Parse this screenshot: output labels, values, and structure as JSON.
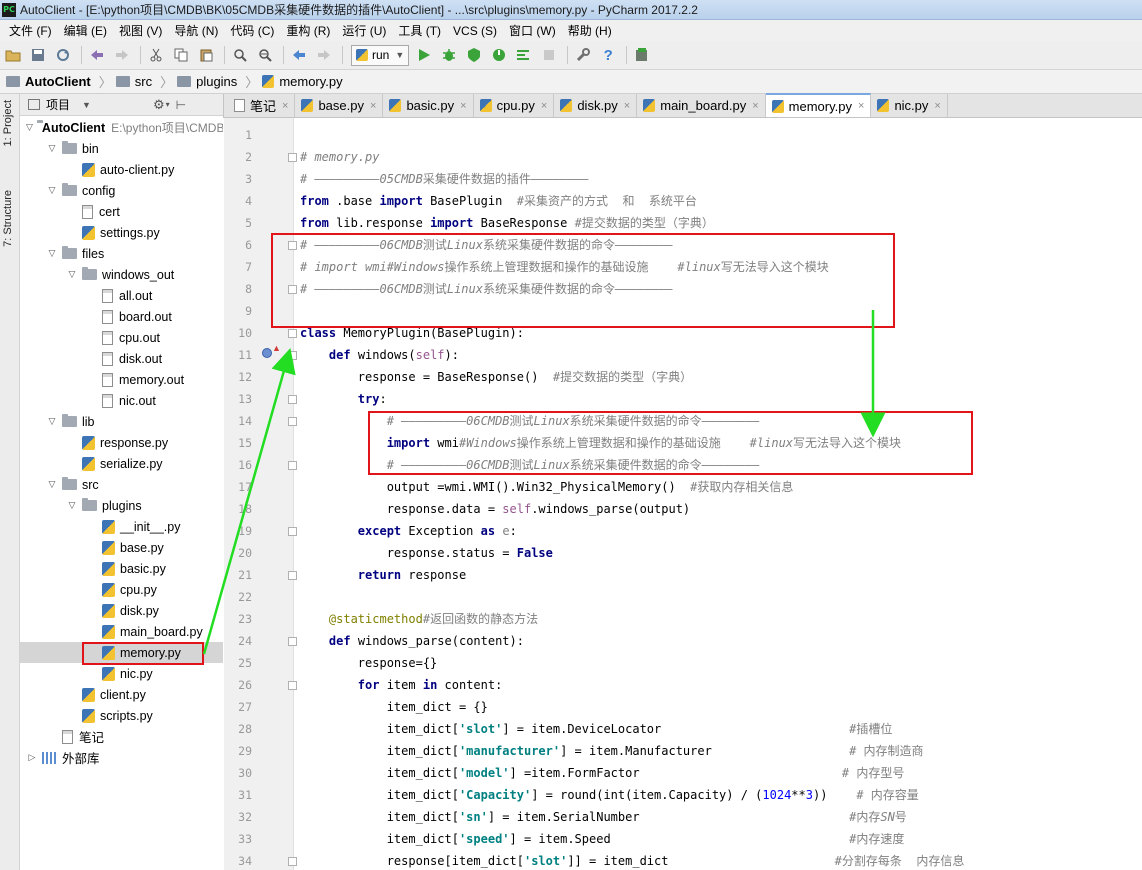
{
  "window": {
    "title": "AutoClient - [E:\\python项目\\CMDB\\BK\\05CMDB采集硬件数据的插件\\AutoClient] - ...\\src\\plugins\\memory.py - PyCharm 2017.2.2",
    "logo": "PC"
  },
  "menu": [
    "文件 (F)",
    "编辑 (E)",
    "视图 (V)",
    "导航 (N)",
    "代码 (C)",
    "重构 (R)",
    "运行 (U)",
    "工具 (T)",
    "VCS (S)",
    "窗口 (W)",
    "帮助 (H)"
  ],
  "toolbar": {
    "run_config": "run"
  },
  "breadcrumb": [
    "AutoClient",
    "src",
    "plugins",
    "memory.py"
  ],
  "stripe": {
    "project_tab": "1: Project",
    "structure_tab": "7: Structure"
  },
  "project": {
    "header": "项目",
    "root_path": "E:\\python项目\\CMDB\\BK",
    "tree": [
      {
        "label": "AutoClient",
        "kind": "folder",
        "depth": 0,
        "open": true
      },
      {
        "label": "bin",
        "kind": "folder",
        "depth": 1,
        "open": true
      },
      {
        "label": "auto-client.py",
        "kind": "py",
        "depth": 2
      },
      {
        "label": "config",
        "kind": "folder",
        "depth": 1,
        "open": true
      },
      {
        "label": "cert",
        "kind": "file",
        "depth": 2
      },
      {
        "label": "settings.py",
        "kind": "py",
        "depth": 2
      },
      {
        "label": "files",
        "kind": "folder",
        "depth": 1,
        "open": true
      },
      {
        "label": "windows_out",
        "kind": "folder",
        "depth": 2,
        "open": true
      },
      {
        "label": "all.out",
        "kind": "file",
        "depth": 3
      },
      {
        "label": "board.out",
        "kind": "file",
        "depth": 3
      },
      {
        "label": "cpu.out",
        "kind": "file",
        "depth": 3
      },
      {
        "label": "disk.out",
        "kind": "file",
        "depth": 3
      },
      {
        "label": "memory.out",
        "kind": "file",
        "depth": 3
      },
      {
        "label": "nic.out",
        "kind": "file",
        "depth": 3
      },
      {
        "label": "lib",
        "kind": "folder",
        "depth": 1,
        "open": true
      },
      {
        "label": "response.py",
        "kind": "py",
        "depth": 2
      },
      {
        "label": "serialize.py",
        "kind": "py",
        "depth": 2
      },
      {
        "label": "src",
        "kind": "folder",
        "depth": 1,
        "open": true
      },
      {
        "label": "plugins",
        "kind": "folder",
        "depth": 2,
        "open": true
      },
      {
        "label": "__init__.py",
        "kind": "py",
        "depth": 3
      },
      {
        "label": "base.py",
        "kind": "py",
        "depth": 3
      },
      {
        "label": "basic.py",
        "kind": "py",
        "depth": 3
      },
      {
        "label": "cpu.py",
        "kind": "py",
        "depth": 3
      },
      {
        "label": "disk.py",
        "kind": "py",
        "depth": 3
      },
      {
        "label": "main_board.py",
        "kind": "py",
        "depth": 3
      },
      {
        "label": "memory.py",
        "kind": "py",
        "depth": 3,
        "selected": true
      },
      {
        "label": "nic.py",
        "kind": "py",
        "depth": 3
      },
      {
        "label": "client.py",
        "kind": "py",
        "depth": 2
      },
      {
        "label": "scripts.py",
        "kind": "py",
        "depth": 2
      },
      {
        "label": "笔记",
        "kind": "file",
        "depth": 1
      },
      {
        "label": "外部库",
        "kind": "lib",
        "depth": 0,
        "open": false
      }
    ]
  },
  "tabs": [
    {
      "label": "笔记",
      "kind": "txt"
    },
    {
      "label": "base.py",
      "kind": "py"
    },
    {
      "label": "basic.py",
      "kind": "py"
    },
    {
      "label": "cpu.py",
      "kind": "py"
    },
    {
      "label": "disk.py",
      "kind": "py"
    },
    {
      "label": "main_board.py",
      "kind": "py"
    },
    {
      "label": "memory.py",
      "kind": "py",
      "active": true
    },
    {
      "label": "nic.py",
      "kind": "py"
    }
  ],
  "code_lines": [
    "",
    "<span class=\"cm\"># memory.py</span>",
    "<span class=\"cm\"># —————————05CMDB</span><span class=\"cmz\">采集硬件数据的插件</span><span class=\"cm\">————————</span>",
    "<span class=\"kw\">from</span> .base <span class=\"kw\">import</span> BasePlugin  <span class=\"cm\">#</span><span class=\"cmz\">采集资产的方式  和  系统平台</span>",
    "<span class=\"kw\">from</span> lib.response <span class=\"kw\">import</span> BaseResponse <span class=\"cm\">#</span><span class=\"cmz\">提交数据的类型（字典）</span>",
    "<span class=\"cm\"># —————————06CMDB</span><span class=\"cmz\">测试</span><span class=\"cm\">Linux</span><span class=\"cmz\">系统采集硬件数据的命令</span><span class=\"cm\">————————</span>",
    "<span class=\"cm\"># import wmi#Windows</span><span class=\"cmz\">操作系统上管理数据和操作的基础设施    </span><span class=\"cm\">#linux</span><span class=\"cmz\">写无法导入这个模块</span>",
    "<span class=\"cm\"># —————————06CMDB</span><span class=\"cmz\">测试</span><span class=\"cm\">Linux</span><span class=\"cmz\">系统采集硬件数据的命令</span><span class=\"cm\">————————</span>",
    "",
    "<span class=\"kw\">class</span> MemoryPlugin(BasePlugin):",
    "    <span class=\"kw\">def</span> windows(<span class=\"slf\">self</span>):",
    "        response = BaseResponse()  <span class=\"cm\">#</span><span class=\"cmz\">提交数据的类型（字典）</span>",
    "        <span class=\"kw\">try</span>:",
    "            <span class=\"cm\"># —————————06CMDB</span><span class=\"cmz\">测试</span><span class=\"cm\">Linux</span><span class=\"cmz\">系统采集硬件数据的命令</span><span class=\"cm\">————————</span>",
    "            <span class=\"kw\">import</span> wmi<span class=\"cm\">#Windows</span><span class=\"cmz\">操作系统上管理数据和操作的基础设施    </span><span class=\"cm\">#linux</span><span class=\"cmz\">写无法导入这个模块</span>",
    "            <span class=\"cm\"># —————————06CMDB</span><span class=\"cmz\">测试</span><span class=\"cm\">Linux</span><span class=\"cmz\">系统采集硬件数据的命令</span><span class=\"cm\">————————</span>",
    "            output =wmi.WMI().Win32_PhysicalMemory()  <span class=\"cm\">#</span><span class=\"cmz\">获取内存相关信息</span>",
    "            response.data = <span class=\"slf\">self</span>.windows_parse(output)",
    "        <span class=\"kw\">except</span> Exception <span class=\"kw\">as</span> <span class=\"prm\">e</span>:",
    "            response.status = <span class=\"kw\">False</span>",
    "        <span class=\"kw\">return</span> response",
    "",
    "    <span class=\"dec\">@staticmethod</span><span class=\"cm\">#</span><span class=\"cmz\">返回函数的静态方法</span>",
    "    <span class=\"kw\">def</span> windows_parse(content):",
    "        response={}",
    "        <span class=\"kw\">for</span> item <span class=\"kw\">in</span> content:",
    "            item_dict = {}",
    "            item_dict[<span class=\"str\">'slot'</span>] = item.DeviceLocator                          <span class=\"cm\">#</span><span class=\"cmz\">插槽位</span>",
    "            item_dict[<span class=\"str\">'manufacturer'</span>] = item.Manufacturer                   <span class=\"cm\"># </span><span class=\"cmz\">内存制造商</span>",
    "            item_dict[<span class=\"str\">'model'</span>] =item.FormFactor                            <span class=\"cm\"># </span><span class=\"cmz\">内存型号</span>",
    "            item_dict[<span class=\"str\">'Capacity'</span>] = round(int(item.Capacity) / (<span class=\"num\">1024</span>**<span class=\"num\">3</span>))    <span class=\"cm\"># </span><span class=\"cmz\">内存容量</span>",
    "            item_dict[<span class=\"str\">'sn'</span>] = item.SerialNumber                             <span class=\"cm\">#</span><span class=\"cmz\">内存</span><span class=\"cm\">SN</span><span class=\"cmz\">号</span>",
    "            item_dict[<span class=\"str\">'speed'</span>] = item.Speed                                 <span class=\"cm\">#</span><span class=\"cmz\">内存速度</span>",
    "            response[item_dict[<span class=\"str\">'slot'</span>]] = item_dict                       <span class=\"cm\">#</span><span class=\"cmz\">分割存每条  内存信息</span>"
  ],
  "fold_lines": [
    2,
    6,
    8,
    10,
    11,
    13,
    14,
    16,
    19,
    21,
    24,
    26,
    34
  ],
  "colors": {
    "annotation_box": "#e1141a",
    "annotation_arrow": "#22dd22"
  }
}
